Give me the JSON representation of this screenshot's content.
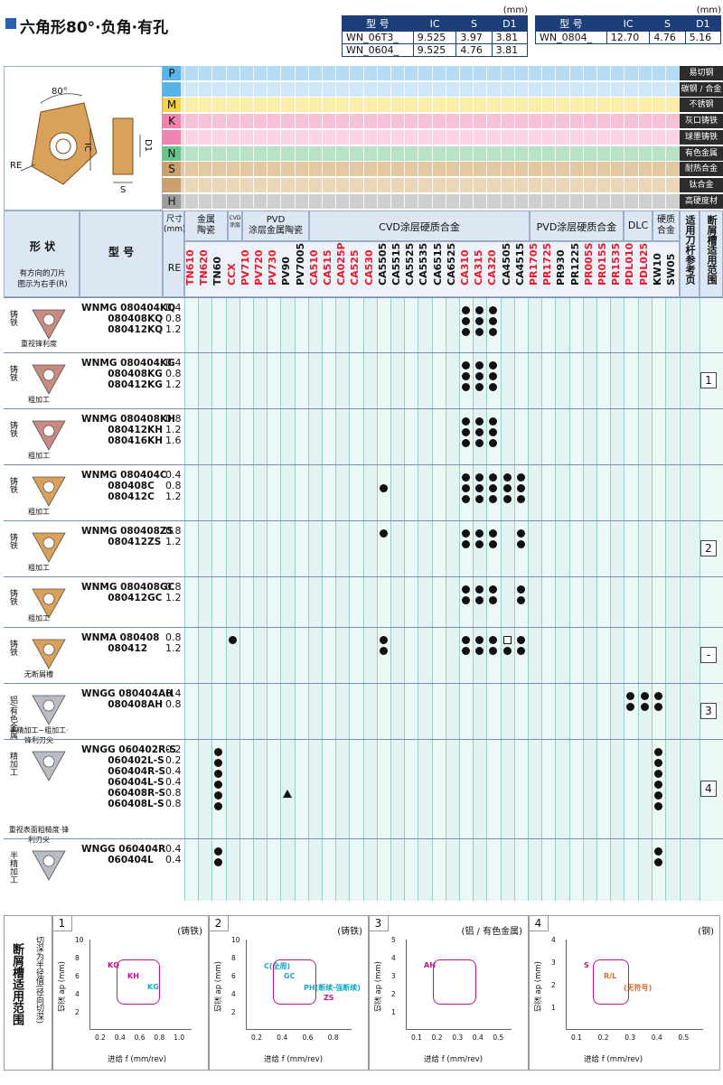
{
  "title": "六角形80°·负角·有孔",
  "spec_left": {
    "unit": "(mm)",
    "headers": [
      "型 号",
      "IC",
      "S",
      "D1"
    ],
    "rows": [
      [
        "WN_06T3_",
        "9.525",
        "3.97",
        "3.81"
      ],
      [
        "WN_0604_",
        "9.525",
        "4.76",
        "3.81"
      ]
    ]
  },
  "spec_right": {
    "unit": "(mm)",
    "headers": [
      "型 号",
      "IC",
      "S",
      "D1"
    ],
    "rows": [
      [
        "WN_0804_",
        "12.70",
        "4.76",
        "5.16"
      ]
    ]
  },
  "diagram": {
    "angle": "80°",
    "re": "RE",
    "ic": "IC",
    "d1": "D1",
    "s": "S"
  },
  "materials": [
    {
      "letter": "P",
      "label": "易切钢",
      "color": "#58b4e8",
      "rowcolor": "#b6dcf3"
    },
    {
      "letter": "",
      "label": "碳钢 / 合金钢",
      "color": "#58b4e8",
      "rowcolor": "#cfe7f6"
    },
    {
      "letter": "M",
      "label": "不锈钢",
      "color": "#f4d24a",
      "rowcolor": "#fbeea8"
    },
    {
      "letter": "K",
      "label": "灰口铸铁",
      "color": "#ee82b0",
      "rowcolor": "#f7c2d9"
    },
    {
      "letter": "",
      "label": "球墨铸铁",
      "color": "#ee82b0",
      "rowcolor": "#fad3e4"
    },
    {
      "letter": "N",
      "label": "有色金属",
      "color": "#66c58a",
      "rowcolor": "#b8e3c6"
    },
    {
      "letter": "S",
      "label": "耐热合金",
      "color": "#c9a06e",
      "rowcolor": "#e3c8a4"
    },
    {
      "letter": "",
      "label": "钛合金",
      "color": "#c9a06e",
      "rowcolor": "#ecd6b8"
    },
    {
      "letter": "H",
      "label": "高硬度材",
      "color": "#9c9c9c",
      "rowcolor": "#cfcfcf"
    }
  ],
  "headers": {
    "shape": "形  状",
    "shape_note": "有方向的刀片\n图示为右手(R)",
    "model": "型  号",
    "size": "尺寸\n(mm)",
    "re": "RE",
    "cermet": "金属\n陶瓷",
    "cvd_d": "CVD\n涂层",
    "pvd_cermet": "PVD\n涂层金属陶瓷",
    "cvd": "CVD涂层硬质合金",
    "pvd": "PVD涂层硬质合金",
    "dlc": "DLC",
    "carbide": "硬质\n合金",
    "toolref": "适用刀杆参考页",
    "chipref": "断屑槽适用范围"
  },
  "grades": [
    {
      "name": "TN610",
      "c": "red"
    },
    {
      "name": "TN620",
      "c": "red"
    },
    {
      "name": "TN60",
      "c": "blk"
    },
    {
      "name": "CCX",
      "c": "red"
    },
    {
      "name": "PV710",
      "c": "red"
    },
    {
      "name": "PV720",
      "c": "red"
    },
    {
      "name": "PV730",
      "c": "red"
    },
    {
      "name": "PV90",
      "c": "blk"
    },
    {
      "name": "PV7005",
      "c": "blk"
    },
    {
      "name": "CA510",
      "c": "red"
    },
    {
      "name": "CA515",
      "c": "red"
    },
    {
      "name": "CA025P",
      "c": "red"
    },
    {
      "name": "CA525",
      "c": "red"
    },
    {
      "name": "CA530",
      "c": "red"
    },
    {
      "name": "CA5505",
      "c": "blk"
    },
    {
      "name": "CA5515",
      "c": "blk"
    },
    {
      "name": "CA5525",
      "c": "blk"
    },
    {
      "name": "CA5535",
      "c": "blk"
    },
    {
      "name": "CA6515",
      "c": "blk"
    },
    {
      "name": "CA6525",
      "c": "blk"
    },
    {
      "name": "CA310",
      "c": "red"
    },
    {
      "name": "CA315",
      "c": "red"
    },
    {
      "name": "CA320",
      "c": "red"
    },
    {
      "name": "CA4505",
      "c": "blk"
    },
    {
      "name": "CA4515",
      "c": "blk"
    },
    {
      "name": "PR1705",
      "c": "red"
    },
    {
      "name": "PR1725",
      "c": "red"
    },
    {
      "name": "PR930",
      "c": "blk"
    },
    {
      "name": "PR1225",
      "c": "blk"
    },
    {
      "name": "PR005S",
      "c": "red"
    },
    {
      "name": "PR015S",
      "c": "red"
    },
    {
      "name": "PR1535",
      "c": "red"
    },
    {
      "name": "PDL010",
      "c": "red"
    },
    {
      "name": "PDL025",
      "c": "red"
    },
    {
      "name": "KW10",
      "c": "blk"
    },
    {
      "name": "SW05",
      "c": "blk"
    }
  ],
  "rows": [
    {
      "mat": "铸铁",
      "caption": "重视锋利度",
      "model": "WNMG 080404KQ\n        080408KQ\n        080412KQ",
      "re": "0.4\n0.8\n1.2",
      "ref": ""
    },
    {
      "mat": "铸铁",
      "caption": "粗加工",
      "model": "WNMG 080404KG\n        080408KG\n        080412KG",
      "re": "0.4\n0.8\n1.2",
      "ref": "1"
    },
    {
      "mat": "铸铁",
      "caption": "粗加工",
      "model": "WNMG 080408KH\n        080412KH\n        080416KH",
      "re": "0.8\n1.2\n1.6",
      "ref": ""
    },
    {
      "mat": "铸铁",
      "caption": "粗加工",
      "model": "WNMG 080404C\n        080408C\n        080412C",
      "re": "0.4\n0.8\n1.2",
      "ref": ""
    },
    {
      "mat": "铸铁",
      "caption": "粗加工",
      "model": "WNMG 080408ZS\n        080412ZS",
      "re": "0.8\n1.2",
      "ref": "2"
    },
    {
      "mat": "铸铁",
      "caption": "粗加工",
      "model": "WNMG 080408GC\n        080412GC",
      "re": "0.8\n1.2",
      "ref": ""
    },
    {
      "mat": "铸铁",
      "caption": "无断屑槽",
      "model": "WNMA 080408\n        080412",
      "re": "0.8\n1.2",
      "ref": "-"
    },
    {
      "mat": "铝/有色金属",
      "caption": "半精加工~粗加工·锋利刃尖",
      "model": "WNGG 080404AH\n        080408AH",
      "re": "0.4\n0.8",
      "ref": "3"
    },
    {
      "mat": "精加工",
      "caption": "重视表面粗糙度·锋利刃尖",
      "model": "WNGG 060402R-S\n        060402L-S\n        060404R-S\n        060404L-S\n        060408R-S\n        060408L-S",
      "re": "0.2\n0.2\n0.4\n0.4\n0.8\n0.8",
      "ref": "4"
    },
    {
      "mat": "半精加工",
      "caption": "",
      "model": "WNGG 060404R\n        060404L",
      "re": "0.4\n0.4",
      "ref": ""
    }
  ],
  "bottom": {
    "side_title": "断屑槽适用范围",
    "side_sub": "切深为半径值(径向切深)",
    "panels": [
      {
        "num": "1",
        "tag": "(铸铁)",
        "ylabel": "切深 ap (mm)",
        "xlabel": "进给 f (mm/rev)",
        "labels": [
          "KQ",
          "KH",
          "KG"
        ],
        "yticks": [
          "10",
          "8",
          "6",
          "4",
          "2"
        ],
        "xticks": [
          "0.2",
          "0.4",
          "0.6",
          "0.8",
          "1.0"
        ]
      },
      {
        "num": "2",
        "tag": "(铸铁)",
        "ylabel": "切深 ap (mm)",
        "xlabel": "进给 f (mm/rev)",
        "labels": [
          "C(全周)",
          "GC",
          "PH(断续·强断续)",
          "ZS"
        ],
        "yticks": [
          "10",
          "8",
          "6",
          "4",
          "2"
        ],
        "xticks": [
          "0.2",
          "0.4",
          "0.6",
          "0.8"
        ]
      },
      {
        "num": "3",
        "tag": "(铝 / 有色金属)",
        "ylabel": "切深 ap (mm)",
        "xlabel": "进给 f (mm/rev)",
        "labels": [
          "AH"
        ],
        "yticks": [
          "5",
          "4",
          "3",
          "2",
          "1"
        ],
        "xticks": [
          "0.1",
          "0.2",
          "0.3",
          "0.4",
          "0.5"
        ]
      },
      {
        "num": "4",
        "tag": "(钢)",
        "ylabel": "切深 ap (mm)",
        "xlabel": "进给 f (mm/rev)",
        "labels": [
          "S",
          "R/L",
          "(无符号)"
        ],
        "yticks": [
          "4",
          "3",
          "2",
          "1"
        ],
        "xticks": [
          "0.1",
          "0.2",
          "0.3",
          "0.4",
          "0.5"
        ]
      }
    ]
  }
}
